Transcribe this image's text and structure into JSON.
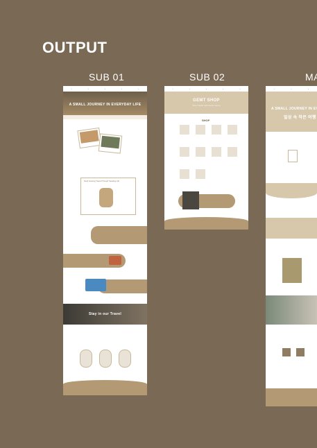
{
  "heading": "OUTPUT",
  "labels": {
    "sub01": "SUB 01",
    "sub02": "SUB 02",
    "main": "MA"
  },
  "sub01": {
    "hero_title": "A SMALL JOURNEY IN EVERYDAY LIFE",
    "section_title": "Send Greeting Travel Through Traveling Life",
    "video_title": "Stay in our Travel"
  },
  "sub02": {
    "hero_title": "GEMT SHOP",
    "hero_sub": "The travel souvenir store",
    "section": "SHOP"
  },
  "main": {
    "hero_title": "A SMALL JOURNEY IN EVERYDAY",
    "hero_sub": "일상 속 작은 여행"
  },
  "colors": {
    "bg": "#7a6a55",
    "accent": "#b39a74",
    "light": "#d7c7ab"
  }
}
